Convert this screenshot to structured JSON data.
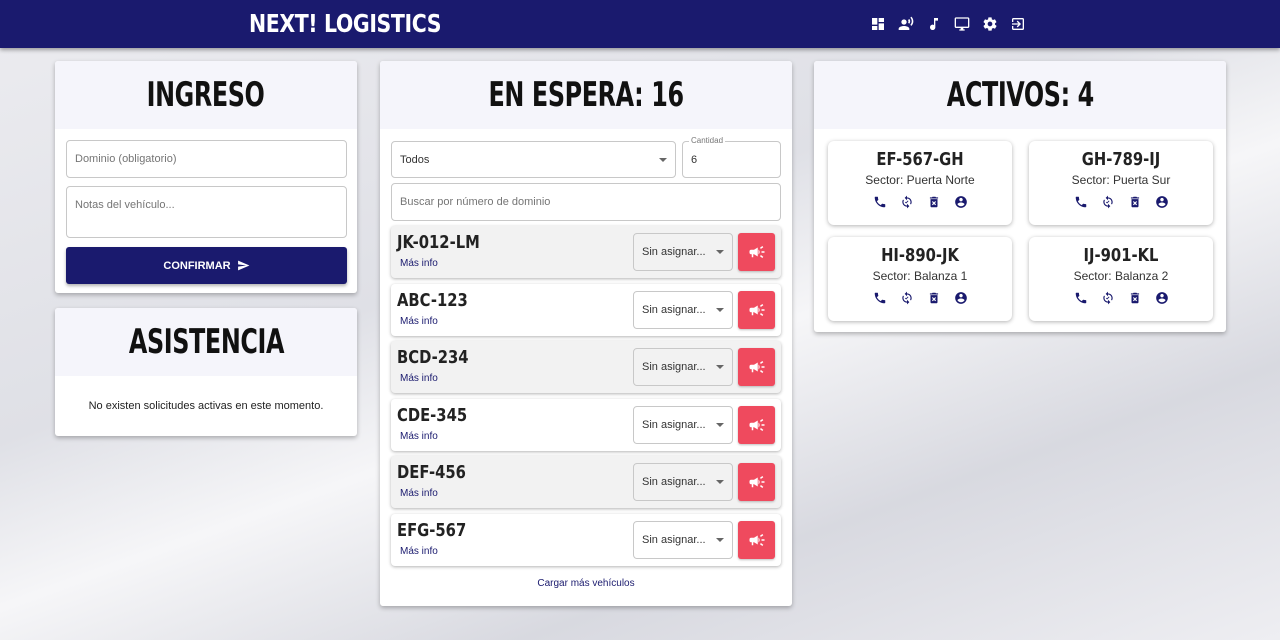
{
  "header": {
    "brand": "NEXT! LOGISTICS",
    "nav_icons": [
      "dashboard-icon",
      "record-voice-icon",
      "music-note-icon",
      "monitor-icon",
      "gear-icon",
      "logout-icon"
    ]
  },
  "ingreso": {
    "title": "INGRESO",
    "domain_placeholder": "Dominio (obligatorio)",
    "notes_placeholder": "Notas del vehículo...",
    "confirm_label": "CONFIRMAR"
  },
  "asistencia": {
    "title": "ASISTENCIA",
    "empty_message": "No existen solicitudes activas en este momento."
  },
  "espera": {
    "title": "EN ESPERA: 16",
    "filter_value": "Todos",
    "qty_label": "Cantidad",
    "qty_value": "6",
    "search_placeholder": "Buscar por número de dominio",
    "more_info_label": "Más info",
    "assign_label": "Sin asignar...",
    "vehicles": [
      {
        "plate": "JK-012-LM"
      },
      {
        "plate": "ABC-123"
      },
      {
        "plate": "BCD-234"
      },
      {
        "plate": "CDE-345"
      },
      {
        "plate": "DEF-456"
      },
      {
        "plate": "EFG-567"
      }
    ],
    "load_more_label": "Cargar más vehículos"
  },
  "activos": {
    "title": "ACTIVOS: 4",
    "vehicles": [
      {
        "plate": "EF-567-GH",
        "sector": "Sector: Puerta Norte"
      },
      {
        "plate": "GH-789-IJ",
        "sector": "Sector: Puerta Sur"
      },
      {
        "plate": "HI-890-JK",
        "sector": "Sector: Balanza 1"
      },
      {
        "plate": "IJ-901-KL",
        "sector": "Sector: Balanza 2"
      }
    ]
  },
  "colors": {
    "primary": "#1a1a6e",
    "call_button": "#ef4a5e",
    "header_band": "#f5f5fb"
  }
}
